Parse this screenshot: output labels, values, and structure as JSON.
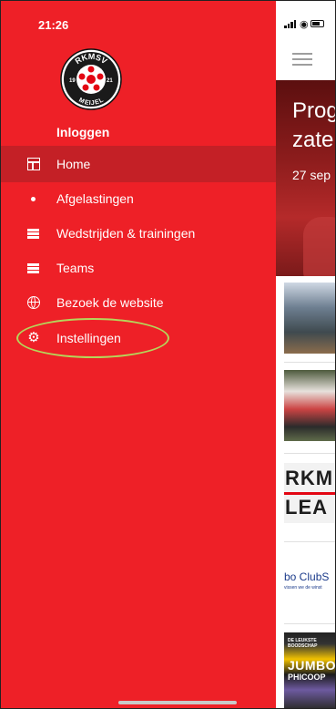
{
  "status_bar": {
    "time": "21:26"
  },
  "drawer": {
    "logo": {
      "top_text": "RKMSV",
      "left_year": "19",
      "right_year": "21",
      "bottom_text": "MEIJEL"
    },
    "login_label": "Inloggen",
    "items": [
      {
        "label": "Home",
        "icon": "table-icon",
        "active": true
      },
      {
        "label": "Afgelastingen",
        "icon": "dot-icon",
        "active": false
      },
      {
        "label": "Wedstrijden & trainingen",
        "icon": "list-icon",
        "active": false
      },
      {
        "label": "Teams",
        "icon": "list-icon",
        "active": false
      },
      {
        "label": "Bezoek de website",
        "icon": "globe-icon",
        "active": false
      },
      {
        "label": "Instellingen",
        "icon": "gear-icon",
        "active": false
      }
    ]
  },
  "content": {
    "hero": {
      "title_line1": "Prog",
      "title_line2": "zate",
      "date": "27 sep"
    },
    "thumbs": [
      {
        "icon": "news-photo-1"
      },
      {
        "icon": "news-photo-2"
      },
      {
        "line1": "RKM",
        "line2": "LEA"
      },
      {
        "line1": "bo ClubS",
        "line2": "vissen we de winst"
      },
      {
        "line1": "DE LEUKSTE BOODSCHAP",
        "line2": "JUMBO",
        "line3": "PHICOOP"
      }
    ]
  },
  "colors": {
    "drawer": "#ee2027",
    "active_item": "#c42026",
    "highlight": "#b5d65a"
  }
}
